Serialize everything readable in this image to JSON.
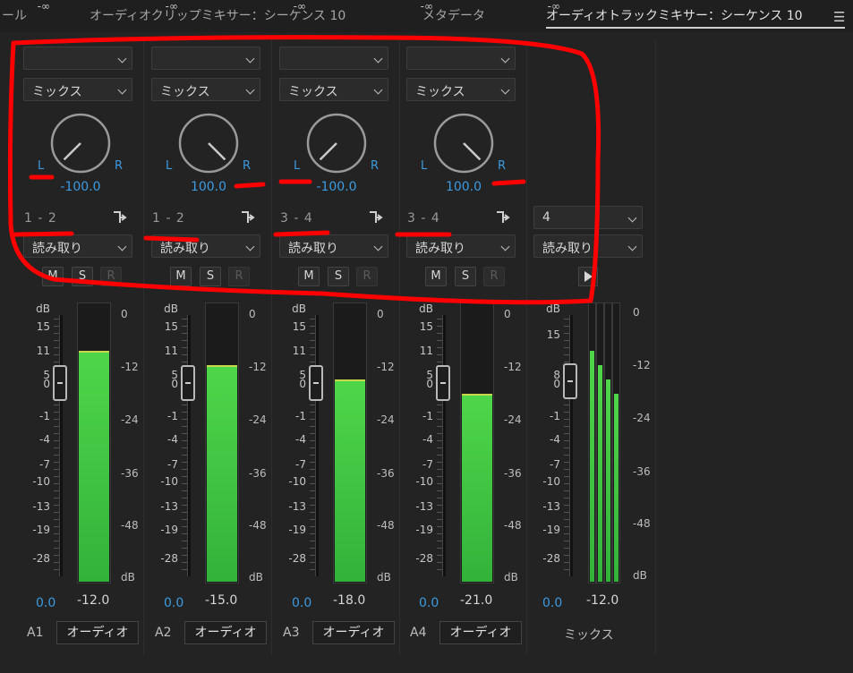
{
  "tabs": [
    {
      "label": "ール",
      "active": false
    },
    {
      "label": "オーディオクリップミキサー：シーケンス 10",
      "active": false
    },
    {
      "label": "メタデータ",
      "active": false
    },
    {
      "label": "オーディオトラックミキサー：シーケンス 10",
      "active": true
    }
  ],
  "menu_icon": "hamburger-menu-icon",
  "channels": [
    {
      "effect": "",
      "mode": "ミックス",
      "pan_l": "L",
      "pan_r": "R",
      "pan_value": "-100.0",
      "route": "1 - 2",
      "automation": "読み取り",
      "m": "M",
      "s": "S",
      "r": "R",
      "volume": "0.0",
      "peak": "-12.0",
      "track_id": "A1",
      "track_name": "オーディオ",
      "level_db": -12
    },
    {
      "effect": "",
      "mode": "ミックス",
      "pan_l": "L",
      "pan_r": "R",
      "pan_value": "100.0",
      "route": "1 - 2",
      "automation": "読み取り",
      "m": "M",
      "s": "S",
      "r": "R",
      "volume": "0.0",
      "peak": "-15.0",
      "track_id": "A2",
      "track_name": "オーディオ",
      "level_db": -15
    },
    {
      "effect": "",
      "mode": "ミックス",
      "pan_l": "L",
      "pan_r": "R",
      "pan_value": "-100.0",
      "route": "3 - 4",
      "automation": "読み取り",
      "m": "M",
      "s": "S",
      "r": "R",
      "volume": "0.0",
      "peak": "-18.0",
      "track_id": "A3",
      "track_name": "オーディオ",
      "level_db": -18
    },
    {
      "effect": "",
      "mode": "ミックス",
      "pan_l": "L",
      "pan_r": "R",
      "pan_value": "100.0",
      "route": "3 - 4",
      "automation": "読み取り",
      "m": "M",
      "s": "S",
      "r": "R",
      "volume": "0.0",
      "peak": "-21.0",
      "track_id": "A4",
      "track_name": "オーディオ",
      "level_db": -21
    }
  ],
  "master": {
    "channels_value": "4",
    "automation": "読み取り",
    "volume": "0.0",
    "peak": "-12.0",
    "name": "ミックス",
    "levels_db": [
      -12,
      -15,
      -18,
      -21
    ]
  },
  "fader_scale": [
    "dB",
    "15",
    "11",
    "5",
    "0",
    "-1",
    "-4",
    "-7",
    "-10",
    "-13",
    "-19",
    "-28",
    "-∞"
  ],
  "master_fader_scale": [
    "dB",
    "15",
    "8",
    "0",
    "-1",
    "-4",
    "-7",
    "-10",
    "-13",
    "-19",
    "-28",
    "-∞"
  ],
  "meter_scale": [
    "0",
    "-12",
    "-24",
    "-36",
    "-48",
    "dB"
  ],
  "accent_color": "#3c9be0",
  "meter_color": "#3fcc41",
  "annotation_color": "#ff0000"
}
